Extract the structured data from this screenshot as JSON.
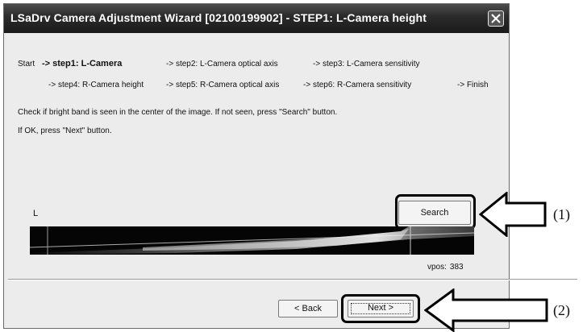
{
  "window": {
    "title": "LSaDrv Camera Adjustment Wizard [02100199902] - STEP1: L-Camera height"
  },
  "steps": {
    "start": "Start",
    "step1": "-> step1: L-Camera",
    "step2": "-> step2: L-Camera optical axis",
    "step3": "-> step3: L-Camera sensitivity",
    "step4": "-> step4: R-Camera height",
    "step5": "-> step5: R-Camera optical axis",
    "step6": "-> step6: R-Camera sensitivity",
    "finish": "-> Finish"
  },
  "instructions": {
    "line1": "Check if bright band is seen in the center of the image. If not seen, press \"Search\" button.",
    "line2": "If OK, press \"Next\" button."
  },
  "camera": {
    "label": "L",
    "search_label": "Search",
    "vpos_label": "vpos:",
    "vpos_value": "383"
  },
  "buttons": {
    "back": "< Back",
    "next": "Next >"
  },
  "annotations": {
    "one": "(1)",
    "two": "(2)"
  }
}
